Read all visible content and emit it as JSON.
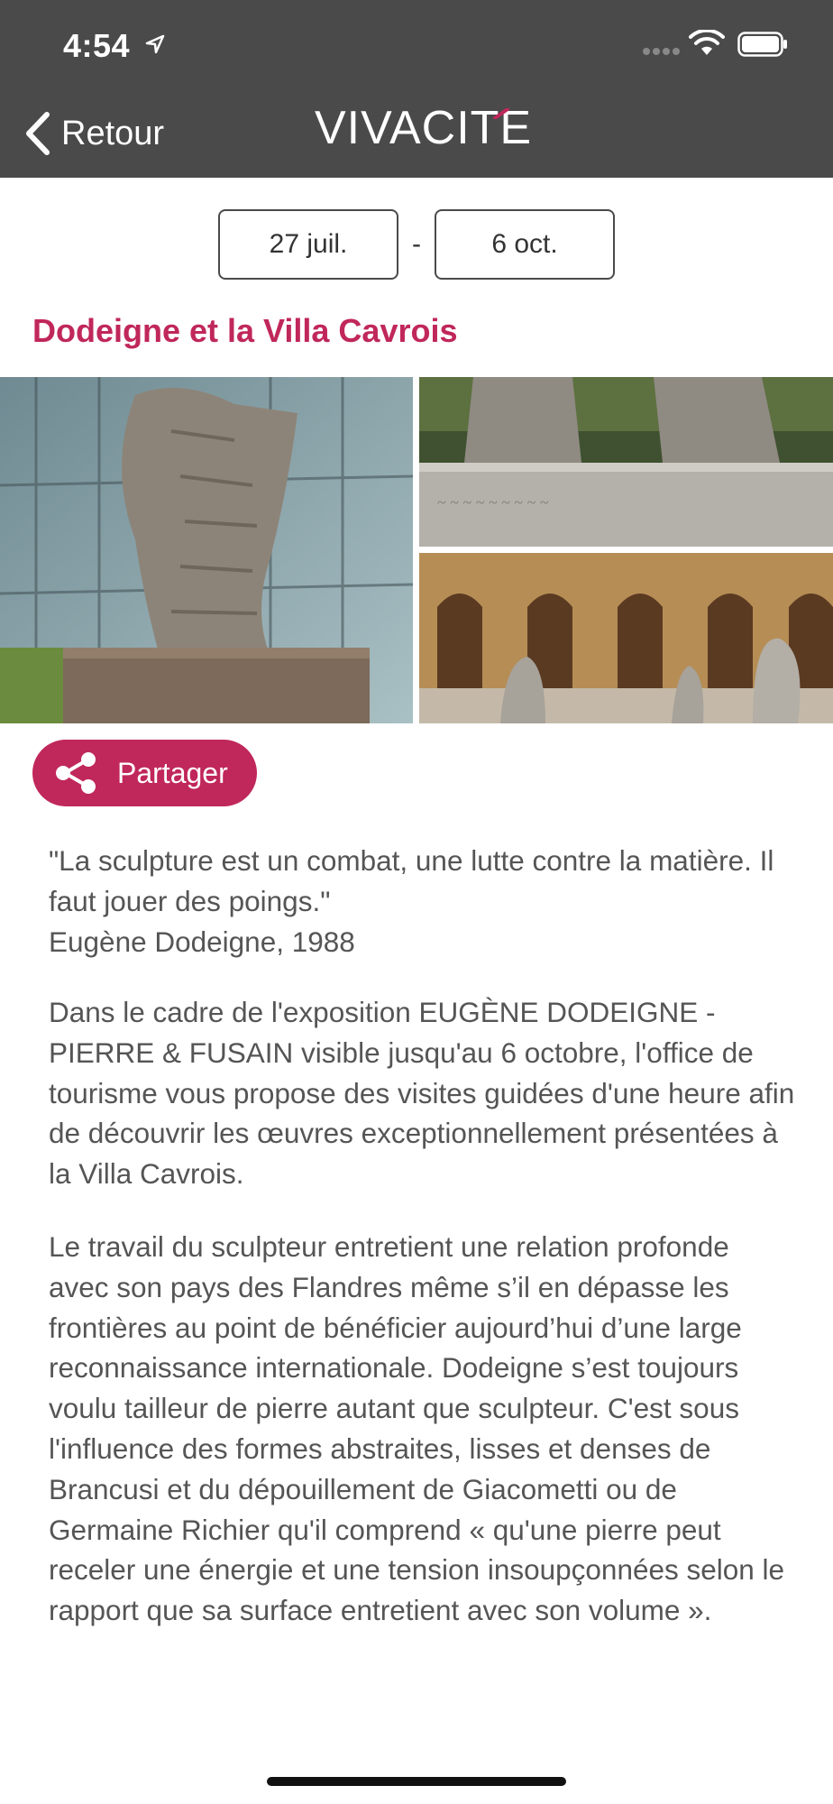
{
  "status_bar": {
    "time": "4:54",
    "icons": [
      "location-arrow-icon",
      "signal-icon",
      "wifi-icon",
      "battery-icon"
    ]
  },
  "nav": {
    "back_label": "Retour",
    "logo_text": "VIVACITE"
  },
  "event": {
    "date_start": "27 juil.",
    "date_separator": "-",
    "date_end": "6 oct.",
    "title": "Dodeigne et la Villa Cavrois"
  },
  "share": {
    "label": "Partager"
  },
  "description": {
    "quote_line1": "\"La sculpture est un combat, une lutte contre la matière. Il faut jouer des poings.\"",
    "quote_author": "Eugène Dodeigne, 1988",
    "paragraph2": "Dans le cadre de l'exposition EUGÈNE DODEIGNE - PIERRE & FUSAIN visible jusqu'au 6 octobre, l'office de tourisme vous propose des visites guidées d'une heure afin de découvrir les œuvres exceptionnellement présentées à la Villa Cavrois.",
    "paragraph3": "Le travail du sculpteur entretient une relation profonde avec son pays des Flandres même s’il en dépasse les frontières au point de bénéficier aujourd’hui d’une large reconnaissance internationale. Dodeigne s’est toujours voulu tailleur de pierre autant que sculpteur. C'est sous l'influence des formes abstraites, lisses et denses de Brancusi et du dépouillement de Giacometti ou de Germaine Richier qu'il comprend « qu'une pierre peut receler une énergie et une tension insoupçonnées selon le rapport que sa surface entretient avec son volume »."
  },
  "colors": {
    "header_bg": "#4a4a4a",
    "accent": "#c0275a",
    "body_text": "#555555"
  }
}
